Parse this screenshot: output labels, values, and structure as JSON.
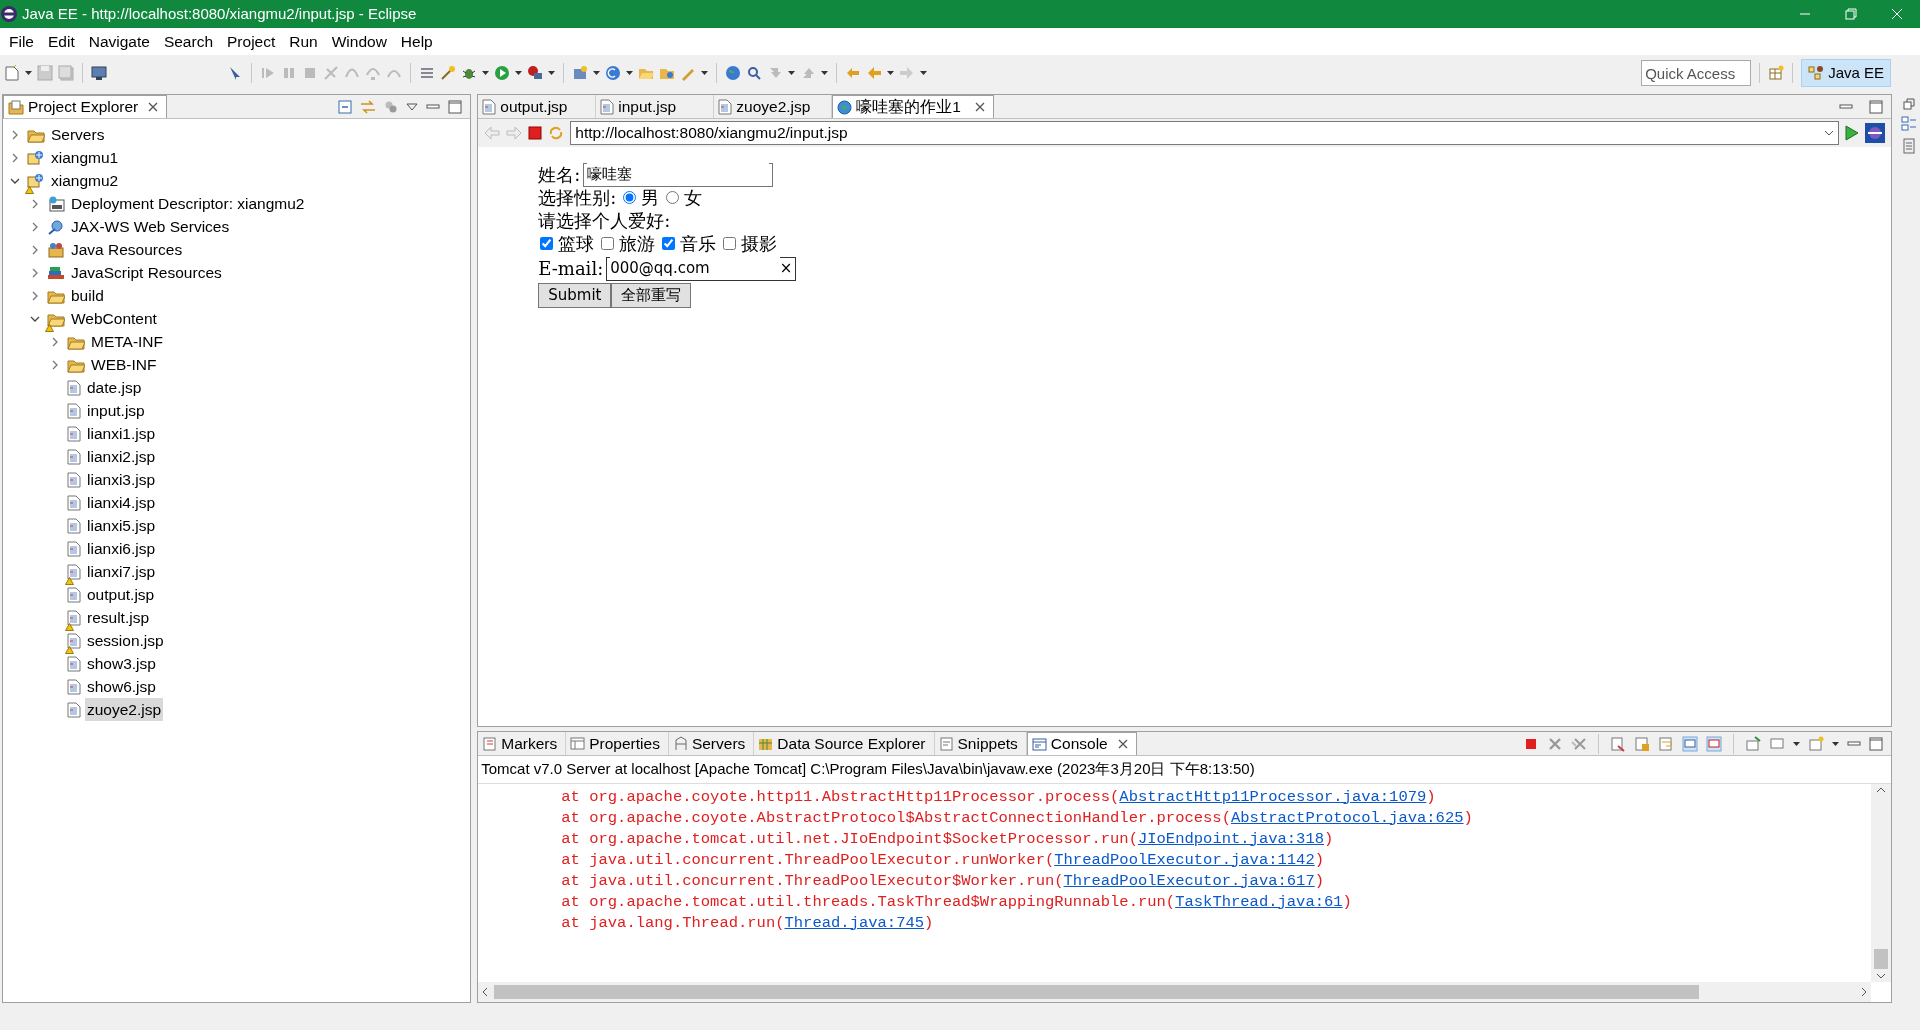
{
  "window": {
    "title": "Java EE - http://localhost:8080/xiangmu2/input.jsp - Eclipse"
  },
  "menu": [
    "File",
    "Edit",
    "Navigate",
    "Search",
    "Project",
    "Run",
    "Window",
    "Help"
  ],
  "quick_access": {
    "placeholder": "Quick Access"
  },
  "perspective": {
    "label": "Java EE",
    "selected": true
  },
  "project_explorer": {
    "title": "Project Explorer",
    "items": [
      {
        "label": "Servers",
        "kind": "folder",
        "expanded": false,
        "warning": false,
        "selected": false
      },
      {
        "label": "xiangmu1",
        "kind": "project",
        "expanded": false,
        "warning": false,
        "selected": false
      },
      {
        "label": "xiangmu2",
        "kind": "project",
        "expanded": true,
        "warning": true,
        "selected": false,
        "children": [
          {
            "label": "Deployment Descriptor: xiangmu2",
            "kind": "descriptor",
            "expanded": false,
            "warning": false,
            "selected": false
          },
          {
            "label": "JAX-WS Web Services",
            "kind": "services",
            "expanded": false,
            "warning": false,
            "selected": false
          },
          {
            "label": "Java Resources",
            "kind": "resources",
            "expanded": false,
            "warning": false,
            "selected": false
          },
          {
            "label": "JavaScript Resources",
            "kind": "books",
            "expanded": false,
            "warning": false,
            "selected": false
          },
          {
            "label": "build",
            "kind": "folder",
            "expanded": false,
            "warning": false,
            "selected": false
          },
          {
            "label": "WebContent",
            "kind": "folder",
            "expanded": true,
            "warning": true,
            "selected": false,
            "children": [
              {
                "label": "META-INF",
                "kind": "folder",
                "expanded": false,
                "warning": false,
                "selected": false
              },
              {
                "label": "WEB-INF",
                "kind": "folder",
                "expanded": false,
                "warning": false,
                "selected": false
              },
              {
                "label": "date.jsp",
                "kind": "file",
                "warning": false,
                "selected": false
              },
              {
                "label": "input.jsp",
                "kind": "file",
                "warning": false,
                "selected": false
              },
              {
                "label": "lianxi1.jsp",
                "kind": "file",
                "warning": false,
                "selected": false
              },
              {
                "label": "lianxi2.jsp",
                "kind": "file",
                "warning": false,
                "selected": false
              },
              {
                "label": "lianxi3.jsp",
                "kind": "file",
                "warning": false,
                "selected": false
              },
              {
                "label": "lianxi4.jsp",
                "kind": "file",
                "warning": false,
                "selected": false
              },
              {
                "label": "lianxi5.jsp",
                "kind": "file",
                "warning": false,
                "selected": false
              },
              {
                "label": "lianxi6.jsp",
                "kind": "file",
                "warning": false,
                "selected": false
              },
              {
                "label": "lianxi7.jsp",
                "kind": "file",
                "warning": true,
                "selected": false
              },
              {
                "label": "output.jsp",
                "kind": "file",
                "warning": false,
                "selected": false
              },
              {
                "label": "result.jsp",
                "kind": "file",
                "warning": true,
                "selected": false
              },
              {
                "label": "session.jsp",
                "kind": "file",
                "warning": true,
                "selected": false
              },
              {
                "label": "show3.jsp",
                "kind": "file",
                "warning": false,
                "selected": false
              },
              {
                "label": "show6.jsp",
                "kind": "file",
                "warning": false,
                "selected": false
              },
              {
                "label": "zuoye2.jsp",
                "kind": "file",
                "warning": false,
                "selected": true
              }
            ]
          }
        ]
      }
    ]
  },
  "editor_tabs": [
    {
      "label": "output.jsp",
      "kind": "file",
      "selected": false
    },
    {
      "label": "input.jsp",
      "kind": "file",
      "selected": false
    },
    {
      "label": "zuoye2.jsp",
      "kind": "file",
      "selected": false
    },
    {
      "label": "嚎哇塞的作业1",
      "kind": "browser",
      "selected": true
    }
  ],
  "browser": {
    "url": "http://localhost:8080/xiangmu2/input.jsp",
    "form": {
      "name_label": "姓名:",
      "name_value": "嚎哇塞",
      "gender_label": "选择性别:",
      "genders": [
        {
          "label": "男",
          "selected": true
        },
        {
          "label": "女",
          "selected": false
        }
      ],
      "hobby_label": "请选择个人爱好:",
      "hobbies": [
        {
          "label": "篮球",
          "checked": true
        },
        {
          "label": "旅游",
          "checked": false
        },
        {
          "label": "音乐",
          "checked": true
        },
        {
          "label": "摄影",
          "checked": false
        }
      ],
      "email_label": "E-mail:",
      "email_value": "000@qq.com",
      "clear": "×",
      "buttons": [
        "Submit",
        "全部重写"
      ]
    }
  },
  "bottom_tabs": [
    {
      "label": "Markers",
      "kind": "markers",
      "selected": false
    },
    {
      "label": "Properties",
      "kind": "properties",
      "selected": false
    },
    {
      "label": "Servers",
      "kind": "servers",
      "selected": false
    },
    {
      "label": "Data Source Explorer",
      "kind": "datasource",
      "selected": false
    },
    {
      "label": "Snippets",
      "kind": "snippets",
      "selected": false
    },
    {
      "label": "Console",
      "kind": "console",
      "selected": true
    }
  ],
  "console": {
    "header": "Tomcat v7.0 Server at localhost [Apache Tomcat] C:\\Program Files\\Java\\bin\\javaw.exe (2023年3月20日 下午8:13:50)",
    "lines": [
      {
        "text": "at org.apache.coyote.http11.AbstractHttp11Processor.process(",
        "link": "AbstractHttp11Processor.java:1079",
        "tail": ")"
      },
      {
        "text": "at org.apache.coyote.AbstractProtocol$AbstractConnectionHandler.process(",
        "link": "AbstractProtocol.java:625",
        "tail": ")"
      },
      {
        "text": "at org.apache.tomcat.util.net.JIoEndpoint$SocketProcessor.run(",
        "link": "JIoEndpoint.java:318",
        "tail": ")"
      },
      {
        "text": "at java.util.concurrent.ThreadPoolExecutor.runWorker(",
        "link": "ThreadPoolExecutor.java:1142",
        "tail": ")"
      },
      {
        "text": "at java.util.concurrent.ThreadPoolExecutor$Worker.run(",
        "link": "ThreadPoolExecutor.java:617",
        "tail": ")"
      },
      {
        "text": "at org.apache.tomcat.util.threads.TaskThread$WrappingRunnable.run(",
        "link": "TaskThread.java:61",
        "tail": ")"
      },
      {
        "text": "at java.lang.Thread.run(",
        "link": "Thread.java:745",
        "tail": ")"
      }
    ]
  }
}
